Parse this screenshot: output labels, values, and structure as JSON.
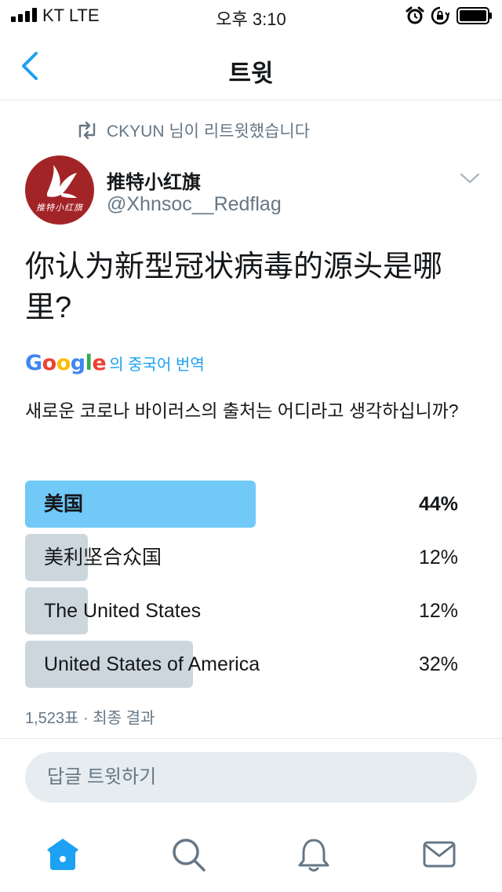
{
  "status_bar": {
    "carrier": "KT LTE",
    "time": "오후 3:10",
    "icons": [
      "signal-icon",
      "alarm-icon",
      "lock-rotation-icon",
      "battery-icon"
    ]
  },
  "header": {
    "title": "트윗",
    "back_icon": "chevron-left-icon"
  },
  "retweet_context": {
    "icon": "retweet-icon",
    "text": "CKYUN 님이 리트윗했습니다"
  },
  "tweet": {
    "display_name": "推特小红旗",
    "handle": "@Xhnsoc__Redflag",
    "avatar_script_text": "推特小红旗",
    "text": "你认为新型冠状病毒的源头是哪里?",
    "translation": {
      "provider": "Google",
      "label": "의 중국어 번역",
      "text": "새로운 코로나 바이러스의 출처는 어디라고 생각하십니까?"
    }
  },
  "poll": {
    "options": [
      {
        "label": "美国",
        "percent_text": "44%",
        "percent": 44,
        "winner": true
      },
      {
        "label": "美利坚合众国",
        "percent_text": "12%",
        "percent": 12,
        "winner": false
      },
      {
        "label": "The United States",
        "percent_text": "12%",
        "percent": 12,
        "winner": false
      },
      {
        "label": "United States of America",
        "percent_text": "32%",
        "percent": 32,
        "winner": false
      }
    ],
    "meta": "1,523표 · 최종 결과"
  },
  "reply": {
    "placeholder": "답글 트윗하기"
  },
  "tab_bar": {
    "tabs": [
      "home-icon",
      "search-icon",
      "notifications-icon",
      "messages-icon"
    ],
    "active_color": "#1da1f2",
    "inactive_color": "#657786"
  },
  "colors": {
    "accent": "#1da1f2",
    "winner_bar": "#71c9f8",
    "other_bar": "#ccd6dd",
    "avatar_bg": "#a32427"
  }
}
